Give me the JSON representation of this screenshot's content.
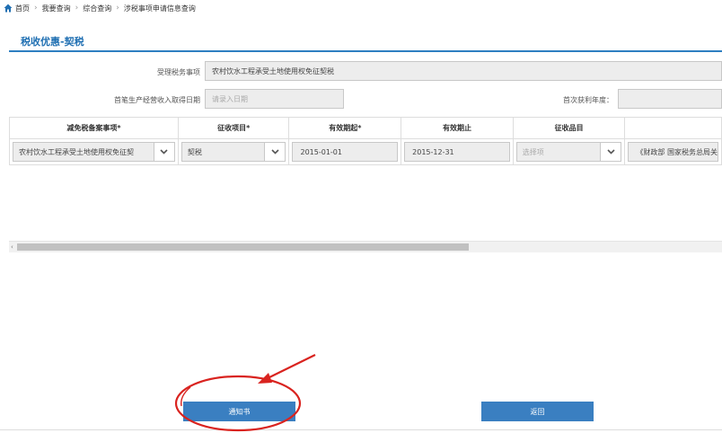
{
  "breadcrumb": [
    "首页",
    "我要查询",
    "综合查询",
    "涉税事项申请信息查询"
  ],
  "page_title": "税收优惠-契税",
  "form": {
    "item_label": "受理税务事项",
    "item_value": "农村饮水工程承受土地使用权免征契税",
    "first_income_date_label": "首笔生产经营收入取得日期",
    "first_income_date_placeholder": "请录入日期",
    "first_profit_year_label": "首次获利年度："
  },
  "table": {
    "headers": [
      "减免税备案事项*",
      "征收项目*",
      "有效期起*",
      "有效期止",
      "征收品目",
      ""
    ],
    "row": {
      "relief_item": "农村饮水工程承受土地使用权免征契",
      "levy_item": "契税",
      "valid_from": "2015-01-01",
      "valid_to": "2015-12-31",
      "levy_category_placeholder": "选择项",
      "policy_basis": "《财政部 国家税务总局关"
    }
  },
  "buttons": {
    "notice": "通知书",
    "back": "返回"
  },
  "colors": {
    "accent": "#2e7fc1",
    "button": "#3a7fc1",
    "annotation": "#d9231f"
  }
}
